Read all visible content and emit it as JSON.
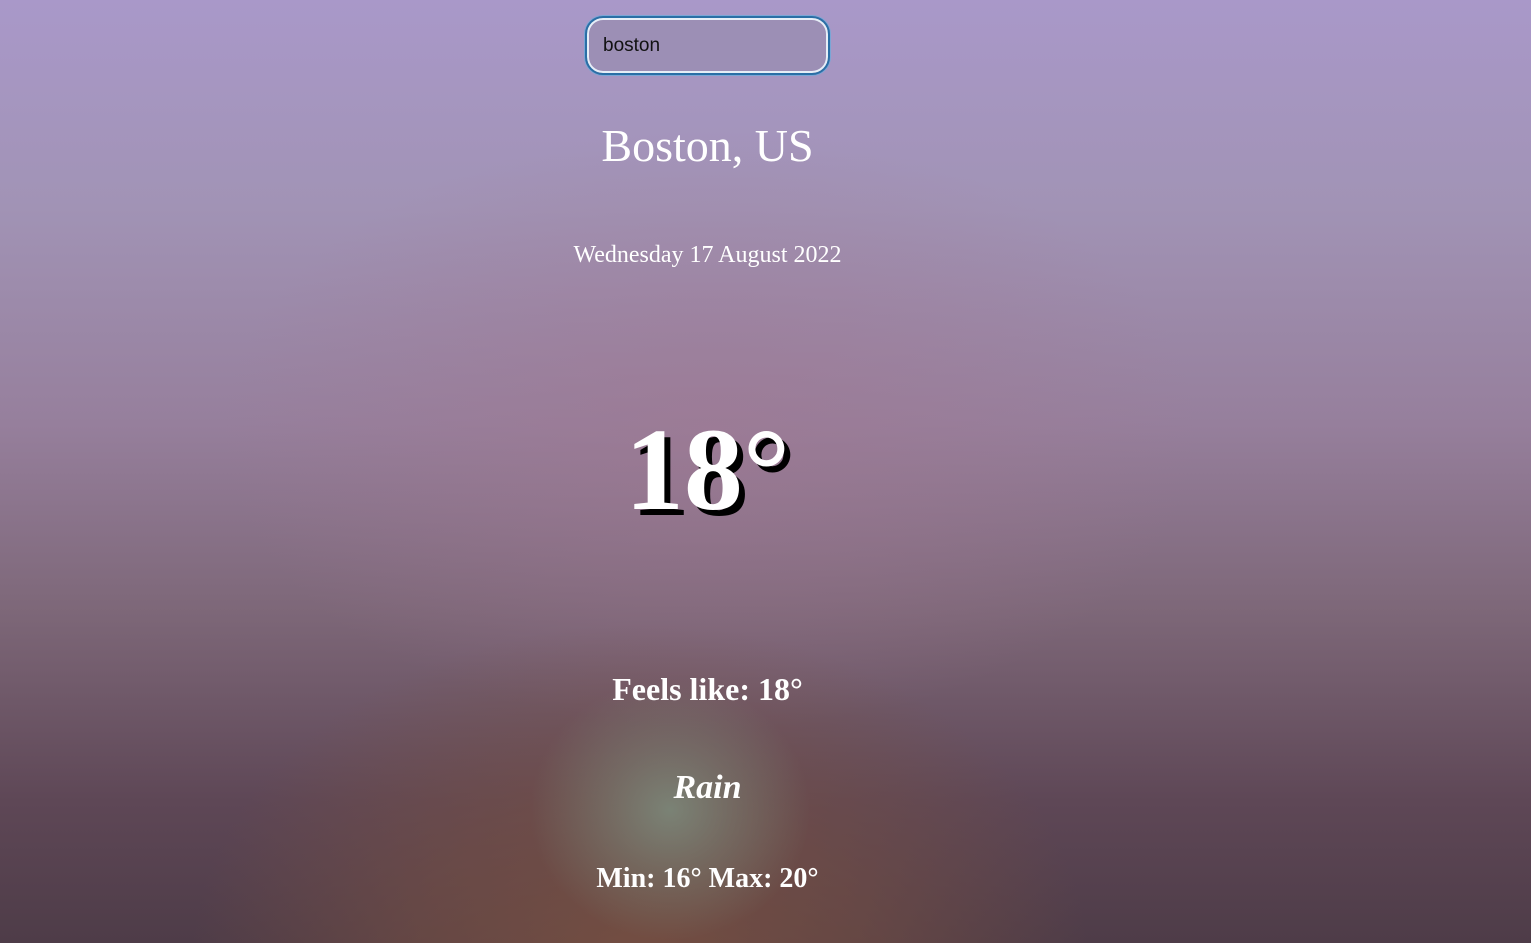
{
  "search": {
    "value": "boston",
    "placeholder": ""
  },
  "weather": {
    "location": "Boston, US",
    "date": "Wednesday 17 August 2022",
    "temperature": "18°",
    "feels_like": "Feels like: 18°",
    "condition": "Rain",
    "min_max": "Min: 16° Max: 20°"
  },
  "colors": {
    "sky_top": "#a998c9",
    "sky_bottom": "#4e3c48",
    "text": "#ffffff",
    "input_border": "#2a6fa6"
  }
}
